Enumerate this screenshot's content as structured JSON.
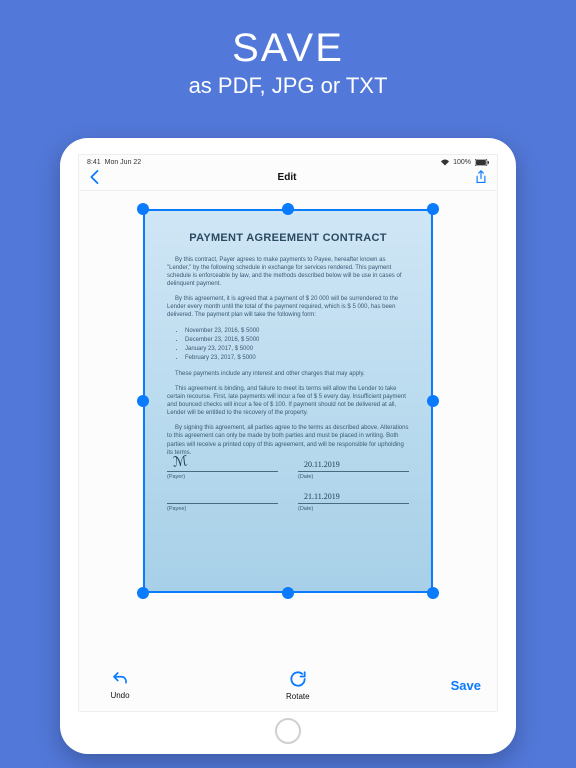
{
  "promo": {
    "title": "SAVE",
    "subtitle": "as PDF, JPG or TXT"
  },
  "statusBar": {
    "time": "8:41",
    "date": "Mon Jun 22",
    "wifi": "100%"
  },
  "nav": {
    "title": "Edit"
  },
  "document": {
    "title": "PAYMENT AGREEMENT CONTRACT",
    "p1": "By this contract, Payer agrees to make payments to Payee, hereafter known as \"Lender,\" by the following schedule in exchange for services rendered. This payment schedule is enforceable by law, and the methods described below will be use in cases of delinquent payment.",
    "p2": "By this agreement, it is agreed that a payment of $ 20 000 will be surrendered to the Lender every month until the total of the payment required, which is $ 5 000, has been delivered. The payment plan will take the following form:",
    "li1": "November 23, 2016, $ 5000",
    "li2": "December 23, 2016, $ 5000",
    "li3": "January 23, 2017, $ 5000",
    "li4": "February 23, 2017, $ 5000",
    "p3": "These payments include any interest and other charges that may apply.",
    "p4": "This agreement is binding, and failure to meet its terms will allow the Lender to take certain recourse. First, late payments will incur a fee of $ 5 every day. Insufficient payment and bounced checks will incur a fee of $ 100. If payment should not be delivered at all, Lender will be entitled to the recovery of the property.",
    "p5": "By signing this agreement, all parties agree to the terms as described above. Alterations to this agreement can only be made by both parties and must be placed in writing. Both parties will receive a printed copy of this agreement, and will be responsible for upholding its terms.",
    "sigLabelPayer": "(Payer)",
    "sigLabelPayee": "(Payee)",
    "sigLabelDate": "(Date)",
    "date1": "20.11.2019",
    "date2": "21.11.2019"
  },
  "toolbar": {
    "undo": "Undo",
    "rotate": "Rotate",
    "save": "Save"
  }
}
